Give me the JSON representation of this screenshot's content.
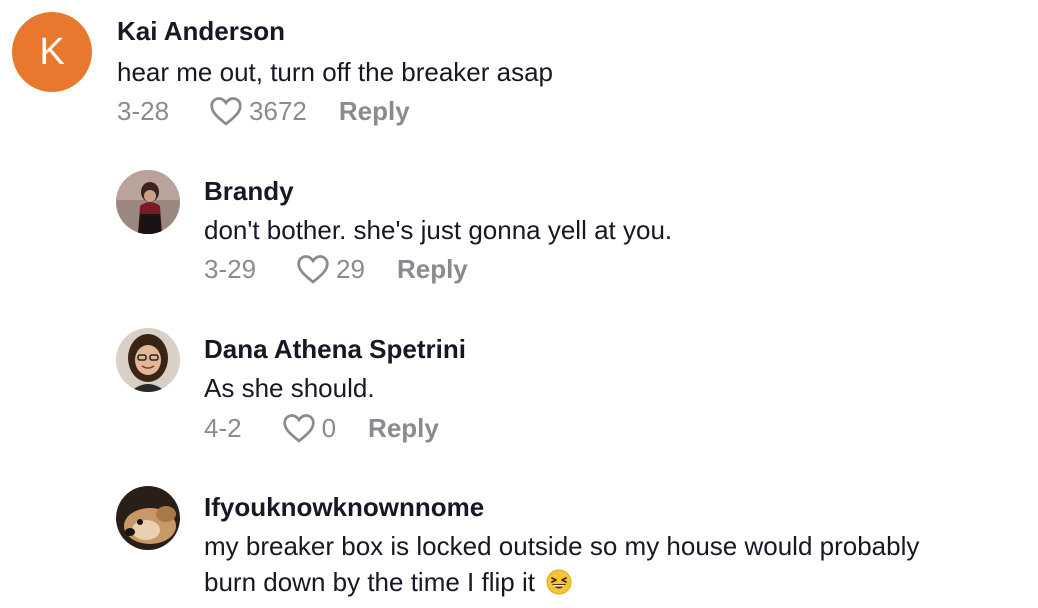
{
  "comments": [
    {
      "avatar_letter": "K",
      "avatar_color": "#e9782f",
      "username": "Kai Anderson",
      "text": "hear me out, turn off the breaker asap",
      "date": "3-28",
      "likes": "3672",
      "reply_label": "Reply"
    },
    {
      "username": "Brandy",
      "text": "don't bother. she's just gonna yell at you.",
      "date": "3-29",
      "likes": "29",
      "reply_label": "Reply"
    },
    {
      "username": "Dana Athena Spetrini",
      "text": "As she should.",
      "date": "4-2",
      "likes": "0",
      "reply_label": "Reply"
    },
    {
      "username": "Ifyouknowknownnome",
      "text_line1": "my breaker box is locked outside so my house would probably",
      "text_line2": "burn down by the time I flip it",
      "emoji": "grinning-squinting-face"
    }
  ],
  "colors": {
    "text_primary": "#161823",
    "text_secondary": "#8a8b91",
    "avatar_orange": "#e9782f"
  }
}
